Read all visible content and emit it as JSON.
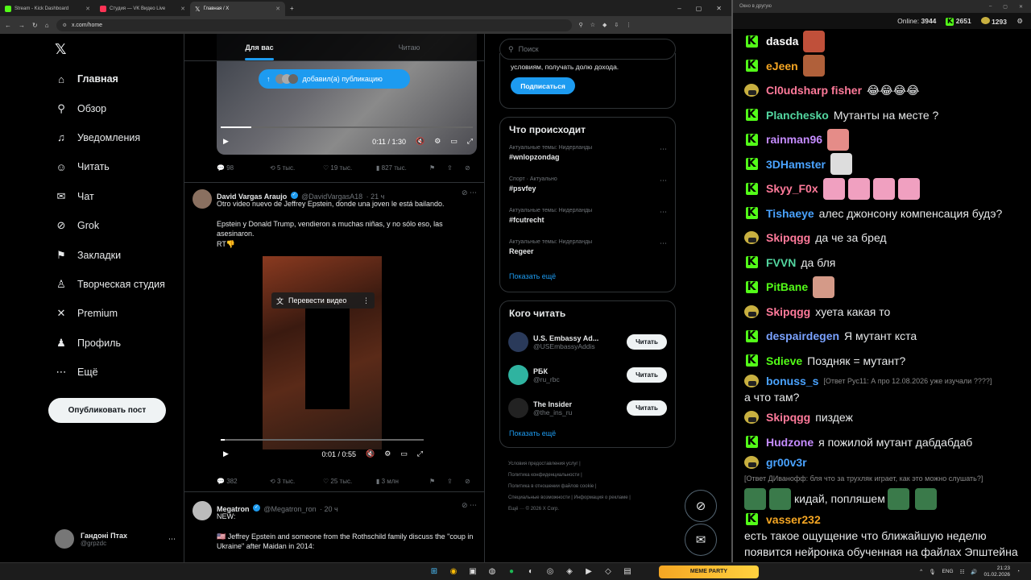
{
  "browser": {
    "tabs": [
      {
        "label": "Stream - Kick Dashboard",
        "color": "#53fc18"
      },
      {
        "label": "Студия — VK Видео Live",
        "color": "#ff3355"
      },
      {
        "label": "Главная / X",
        "color": "#ffffff"
      }
    ],
    "url": "x.com/home"
  },
  "x_nav": {
    "items": [
      {
        "label": "Главная",
        "icon": "home-icon",
        "glyph": "⌂"
      },
      {
        "label": "Обзор",
        "icon": "search-icon",
        "glyph": "⚲"
      },
      {
        "label": "Уведомления",
        "icon": "bell-icon",
        "glyph": "♫"
      },
      {
        "label": "Читать",
        "icon": "person-add-icon",
        "glyph": "☺"
      },
      {
        "label": "Чат",
        "icon": "mail-icon",
        "glyph": "✉"
      },
      {
        "label": "Grok",
        "icon": "grok-icon",
        "glyph": "⊘"
      },
      {
        "label": "Закладки",
        "icon": "bookmark-icon",
        "glyph": "⚑"
      },
      {
        "label": "Творческая студия",
        "icon": "studio-icon",
        "glyph": "♙"
      },
      {
        "label": "Premium",
        "icon": "x-logo-icon",
        "glyph": "✕"
      },
      {
        "label": "Профиль",
        "icon": "profile-icon",
        "glyph": "♟"
      },
      {
        "label": "Ещё",
        "icon": "more-icon",
        "glyph": "⋯"
      }
    ],
    "post_button": "Опубликовать пост",
    "account": {
      "name": "Гандоні Птах",
      "handle": "@grpzdc"
    }
  },
  "timeline": {
    "tabs": [
      "Для вас",
      "Читаю"
    ],
    "toast": "добавил(а) публикацию",
    "tweet0": {
      "time": "0:11 / 1:30",
      "replies": "98",
      "reposts": "5 тыс.",
      "likes": "19 тыс.",
      "views": "827 тыс."
    },
    "tweet1": {
      "name": "David Vargas Araujo",
      "handle": "@DavidVargasA18",
      "age": "· 21 ч",
      "line1": "Otro video nuevo de Jeffrey Epstein, donde una joven le está bailando.",
      "line2": "Epstein y Donald Trump, vendieron a muchas niñas, y no sólo eso, las asesinaron.",
      "line3": "RT👎",
      "translate": "Перевести видео",
      "time": "0:01 / 0:55",
      "replies": "382",
      "reposts": "3 тыс.",
      "likes": "25 тыс.",
      "views": "3 млн"
    },
    "tweet2": {
      "name": "Megatron",
      "handle": "@Megatron_ron",
      "age": "· 20 ч",
      "line1": "NEW:",
      "line2": "🇺🇸 Jeffrey Epstein and someone from the Rothschild family discuss the \"coup in Ukraine\" after Maidan in 2014:"
    }
  },
  "right": {
    "search_placeholder": "Поиск",
    "premium_text": "условиям, получать долю дохода.",
    "subscribe": "Подписаться",
    "trends_title": "Что происходит",
    "trends": [
      {
        "cat": "Актуальные темы: Нидерланды",
        "name": "#wnlopzondag"
      },
      {
        "cat": "Спорт · Актуально",
        "name": "#psvfey"
      },
      {
        "cat": "Актуальные темы: Нидерланды",
        "name": "#fcutrecht"
      },
      {
        "cat": "Актуальные темы: Нидерланды",
        "name": "Regeer"
      }
    ],
    "show_more": "Показать ещё",
    "who_title": "Кого читать",
    "who": [
      {
        "name": "U.S. Embassy Ad...",
        "handle": "@USEmbassyAddis",
        "btn": "Читать"
      },
      {
        "name": "РБК",
        "handle": "@ru_rbc",
        "btn": "Читать"
      },
      {
        "name": "The Insider",
        "handle": "@the_ins_ru",
        "btn": "Читать"
      }
    ],
    "footer": [
      "Условия предоставления услуг |",
      "Политика конфиденциальности |",
      "Политика в отношении файлов cookie |",
      "Специальные возможности | Информация о рекламе |",
      "Ещё ··· © 2026 X Corp."
    ]
  },
  "chat": {
    "title": "Окно в другую",
    "online_label": "Online:",
    "online": "3944",
    "kick_count": "2651",
    "dlive_count": "1293",
    "messages": [
      {
        "badge": "k",
        "user": "dasda",
        "color": "#ffffff",
        "text": "",
        "emotes": 1,
        "ecolor": "#c0503a"
      },
      {
        "badge": "k",
        "user": "eJeen",
        "color": "#f5a623",
        "text": "",
        "emotes": 1,
        "ecolor": "#b0603a"
      },
      {
        "badge": "d",
        "user": "Cl0udsharp fisher",
        "color": "#ff7a9a",
        "text": "😂😂😂😂",
        "emotes": 0,
        "ecolor": ""
      },
      {
        "badge": "k",
        "user": "Planchesko",
        "color": "#53d6a0",
        "text": "Мутанты на месте ?",
        "emotes": 0,
        "ecolor": ""
      },
      {
        "badge": "k",
        "user": "rainman96",
        "color": "#c58cff",
        "text": "",
        "emotes": 1,
        "ecolor": "#e58c88"
      },
      {
        "badge": "k",
        "user": "3DHamster",
        "color": "#4aa3ff",
        "text": "",
        "emotes": 1,
        "ecolor": "#dddddd"
      },
      {
        "badge": "k",
        "user": "Skyy_F0x",
        "color": "#ff7a9a",
        "text": "",
        "emotes": 4,
        "ecolor": "#f0a0c0"
      },
      {
        "badge": "k",
        "user": "Tishaeye",
        "color": "#4aa3ff",
        "text": "алес джонсону компенсация будэ?",
        "emotes": 0,
        "ecolor": ""
      },
      {
        "badge": "d",
        "user": "Skipqgg",
        "color": "#ff7a9a",
        "text": "да че за бред",
        "emotes": 0,
        "ecolor": ""
      },
      {
        "badge": "k",
        "user": "FVVN",
        "color": "#53d6a0",
        "text": "да бля",
        "emotes": 0,
        "ecolor": ""
      },
      {
        "badge": "k",
        "user": "PitBane",
        "color": "#53fc18",
        "text": "",
        "emotes": 1,
        "ecolor": "#d49a88"
      },
      {
        "badge": "d",
        "user": "Skipqgg",
        "color": "#ff7a9a",
        "text": "хуета какая то",
        "emotes": 0,
        "ecolor": ""
      },
      {
        "badge": "k",
        "user": "despairdegen",
        "color": "#7aa2ff",
        "text": "Я мутант кста",
        "emotes": 0,
        "ecolor": ""
      },
      {
        "badge": "k",
        "user": "Sdieve",
        "color": "#53fc18",
        "text": "Поздняк = мутант?",
        "emotes": 0,
        "ecolor": ""
      },
      {
        "badge": "d",
        "user": "bonuss_s",
        "color": "#4aa3ff",
        "reply": "[Ответ Рус11: А про 12.08.2026 уже изучали ????]",
        "text": "а что там?",
        "emotes": 0,
        "ecolor": ""
      },
      {
        "badge": "d",
        "user": "Skipqgg",
        "color": "#ff7a9a",
        "text": "пиздеж",
        "emotes": 0,
        "ecolor": ""
      },
      {
        "badge": "k",
        "user": "Hudzone",
        "color": "#c58cff",
        "text": "я пожилой мутант дабдабдаб",
        "emotes": 0,
        "ecolor": ""
      },
      {
        "badge": "d",
        "user": "gr00v3r",
        "color": "#4aa3ff",
        "reply": "[Ответ ДИванофф: бля что за трухляк играет, как это можно слушать?]",
        "text": "",
        "emotes": 0,
        "ecolor": ""
      },
      {
        "badge": "",
        "user": "",
        "color": "#ffffff",
        "text": "кидай, попляшем",
        "emotes": 2,
        "ecolor": "#3a7a4a",
        "trail": 2
      },
      {
        "badge": "k",
        "user": "vasser232",
        "color": "#f5a623",
        "text": "есть такое ощущение что ближайшую неделю появится нейронка обученная на файлах Эпштейна",
        "emotes": 0,
        "ecolor": ""
      }
    ]
  },
  "taskbar": {
    "lang": "ENG",
    "time": "21:23",
    "date": "01.02.2026",
    "widget": "MEME PARTY"
  }
}
